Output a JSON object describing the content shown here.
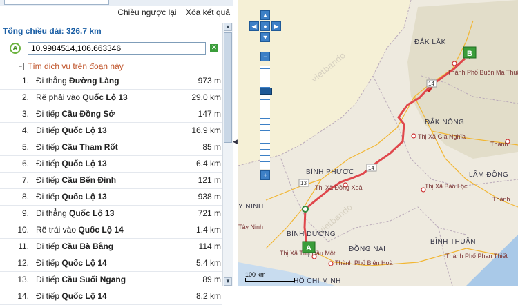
{
  "header": {
    "reverse_label": "Chiều ngược lại",
    "clear_result_label": "Xóa kết quả"
  },
  "summary": {
    "total_label": "Tổng chiều dài: 326.7 km"
  },
  "start": {
    "pin_label": "A",
    "address_value": "10.9984514,106.663346",
    "clear_icon": "x-icon"
  },
  "services": {
    "toggle_symbol": "−",
    "label": "Tìm dịch vụ trên đoạn này"
  },
  "steps": [
    {
      "num": "1.",
      "action": "Đi thẳng",
      "road": "Đường Làng",
      "dist": "973 m"
    },
    {
      "num": "2.",
      "action": "Rẽ phải vào",
      "road": "Quốc Lộ 13",
      "dist": "29.0 km"
    },
    {
      "num": "3.",
      "action": "Đi tiếp",
      "road": "Cầu Đồng Sở",
      "dist": "147 m"
    },
    {
      "num": "4.",
      "action": "Đi tiếp",
      "road": "Quốc Lộ 13",
      "dist": "16.9 km"
    },
    {
      "num": "5.",
      "action": "Đi tiếp",
      "road": "Cầu Tham Rốt",
      "dist": "85 m"
    },
    {
      "num": "6.",
      "action": "Đi tiếp",
      "road": "Quốc Lộ 13",
      "dist": "6.4 km"
    },
    {
      "num": "7.",
      "action": "Đi tiếp",
      "road": "Cầu Bến Đình",
      "dist": "121 m"
    },
    {
      "num": "8.",
      "action": "Đi tiếp",
      "road": "Quốc Lộ 13",
      "dist": "938 m"
    },
    {
      "num": "9.",
      "action": "Đi thẳng",
      "road": "Quốc Lộ 13",
      "dist": "721 m"
    },
    {
      "num": "10.",
      "action": "Rẽ trái vào",
      "road": "Quốc Lộ 14",
      "dist": "1.4 km"
    },
    {
      "num": "11.",
      "action": "Đi tiếp",
      "road": "Cầu Bà Bằng",
      "dist": "114 m"
    },
    {
      "num": "12.",
      "action": "Đi tiếp",
      "road": "Quốc Lộ 14",
      "dist": "5.4 km"
    },
    {
      "num": "13.",
      "action": "Đi tiếp",
      "road": "Cầu Suối Ngang",
      "dist": "89 m"
    },
    {
      "num": "14.",
      "action": "Đi tiếp",
      "road": "Quốc Lộ 14",
      "dist": "8.2 km"
    }
  ],
  "map": {
    "provinces": [
      "ĐẮK LẮK",
      "ĐẮK NÔNG",
      "BÌNH PHƯỚC",
      "LÂM ĐỒNG",
      "BÌNH DƯƠNG",
      "ĐỒNG NAI",
      "BÌNH THUẬN",
      "Y NINH",
      "HỒ CHÍ MINH"
    ],
    "cities": [
      "Thành Phố Buôn Ma Thuột",
      "Thị Xã Gia Nghĩa",
      "Thị Xã Đồng Xoài",
      "Thị Xã Bảo Lộc",
      "Thị Xã Thủ Dầu Một",
      "Thành Phố Biên Hoà",
      "Thành Phố Phan Thiết",
      "Thành",
      "Thành",
      "Tây Ninh"
    ],
    "road_shields": [
      "14",
      "14",
      "13"
    ],
    "marker_a": "A",
    "marker_b": "B",
    "scale_label": "100 km",
    "route_color": "#e0474c",
    "watermark": "vietbando"
  }
}
